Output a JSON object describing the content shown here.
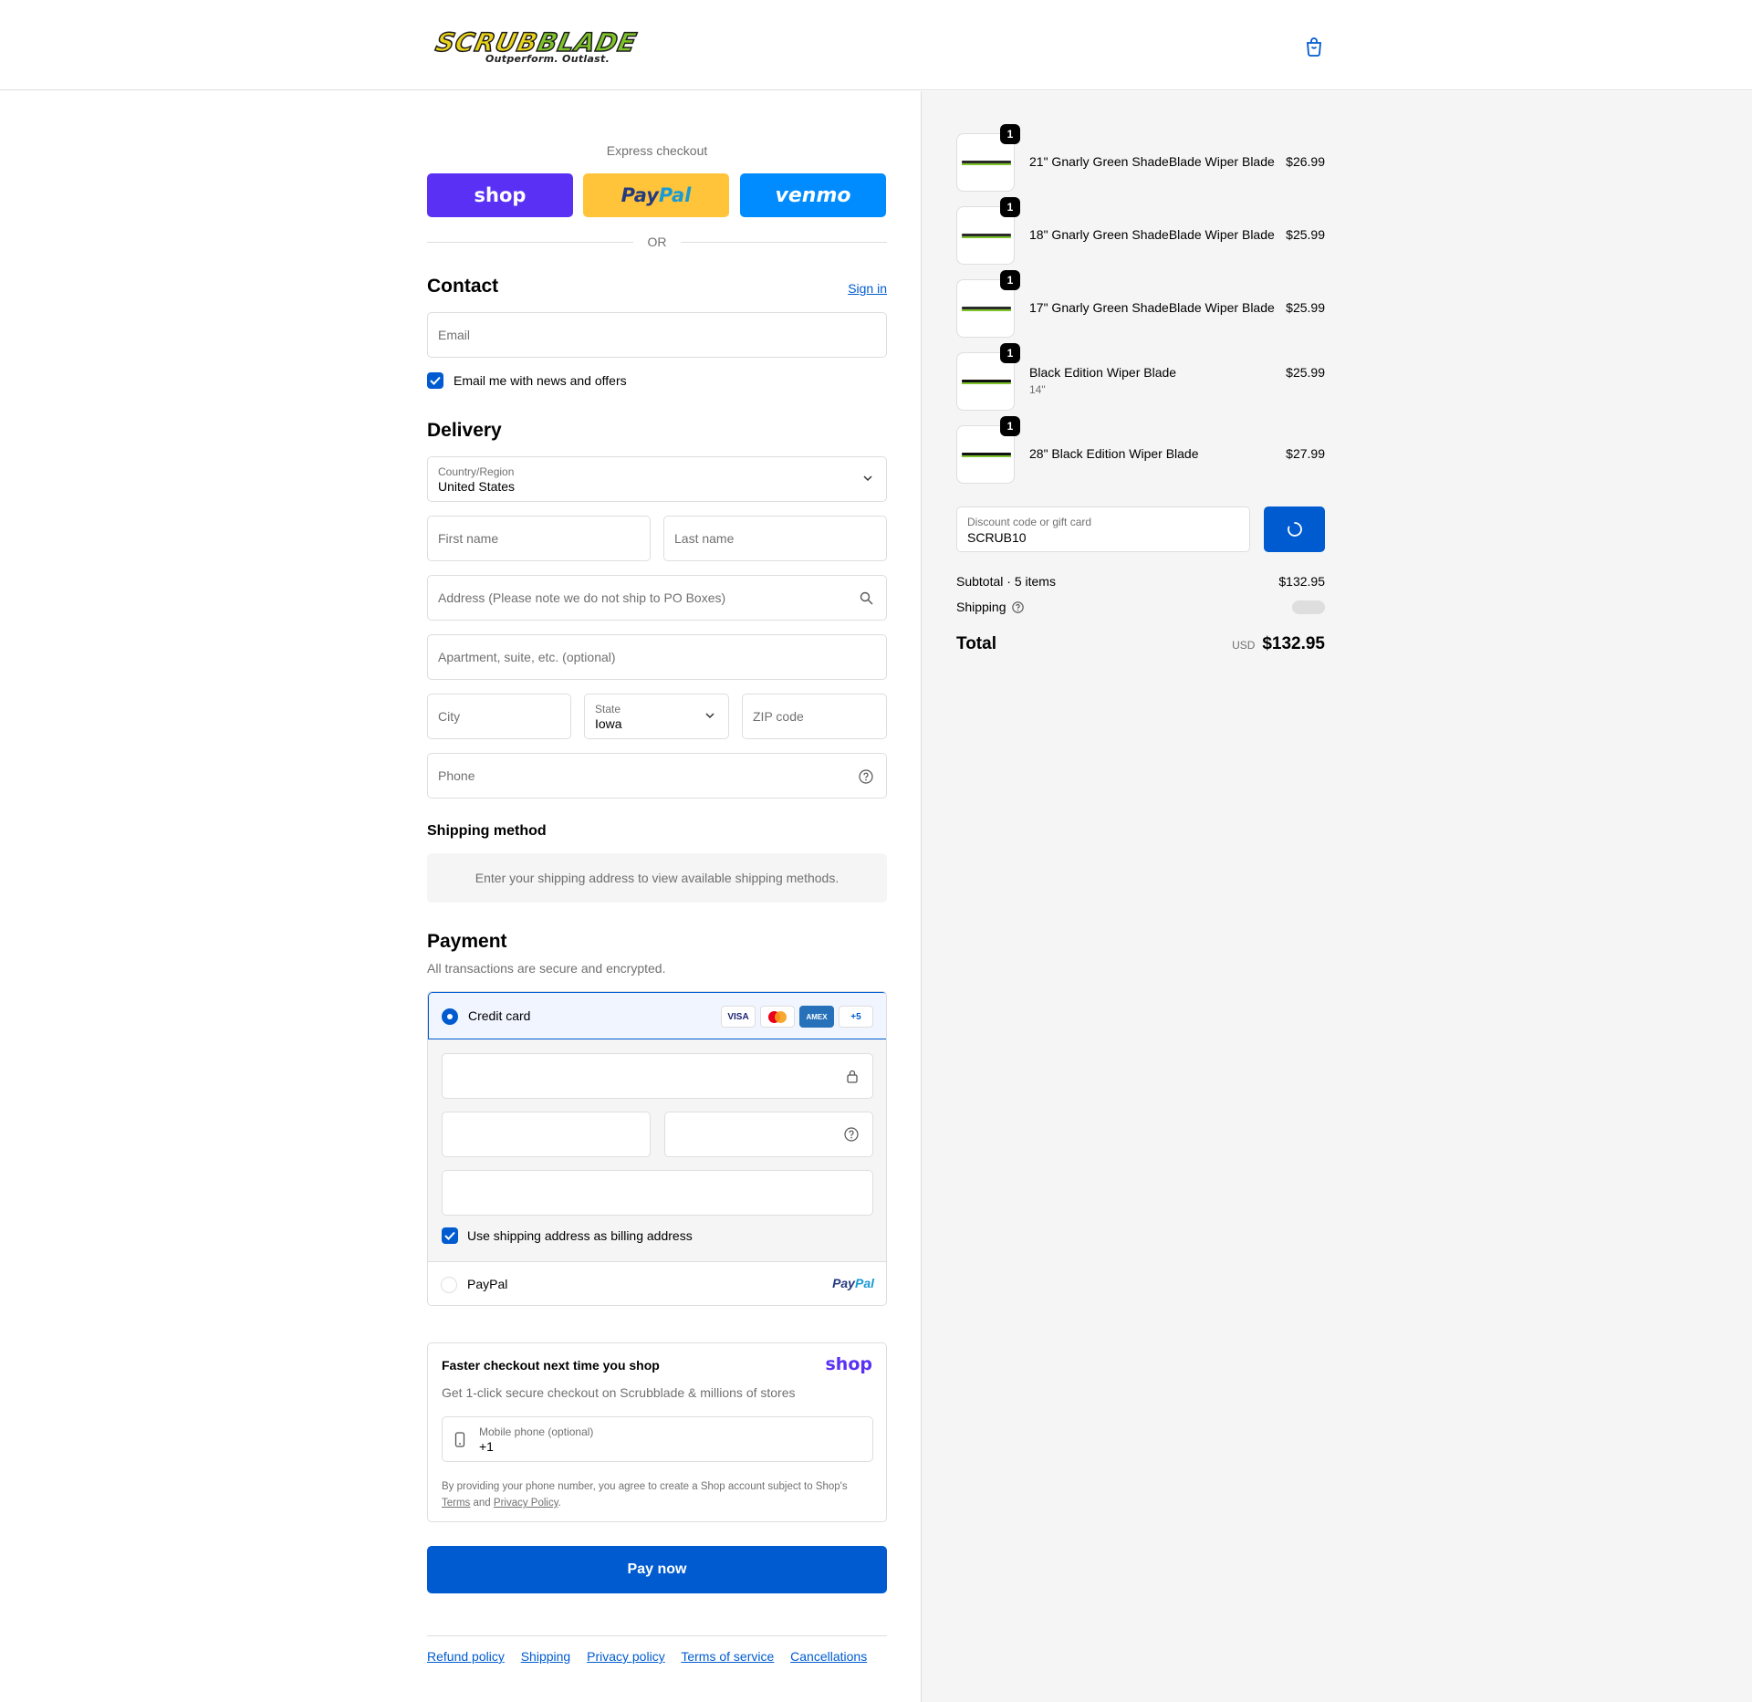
{
  "brand": {
    "logo_text_a": "SCRUB",
    "logo_text_b": "BLADE",
    "tagline": "Outperform. Outlast."
  },
  "express": {
    "title": "Express checkout",
    "shop_label": "shop",
    "paypal_label_a": "Pay",
    "paypal_label_b": "Pal",
    "venmo_label": "venmo",
    "or_label": "OR"
  },
  "contact": {
    "heading": "Contact",
    "sign_in": "Sign in",
    "email_placeholder": "Email",
    "newsletter_label": "Email me with news and offers",
    "newsletter_checked": true
  },
  "delivery": {
    "heading": "Delivery",
    "country_label": "Country/Region",
    "country_value": "United States",
    "first_name_placeholder": "First name",
    "last_name_placeholder": "Last name",
    "address_placeholder": "Address (Please note we do not ship to PO Boxes)",
    "apartment_placeholder": "Apartment, suite, etc. (optional)",
    "city_placeholder": "City",
    "state_label": "State",
    "state_value": "Iowa",
    "zip_placeholder": "ZIP code",
    "phone_placeholder": "Phone"
  },
  "shipping_method": {
    "heading": "Shipping method",
    "message": "Enter your shipping address to view available shipping methods."
  },
  "payment": {
    "heading": "Payment",
    "subtitle": "All transactions are secure and encrypted.",
    "credit_card_label": "Credit card",
    "card_brands": [
      "VISA",
      "MC",
      "AMEX",
      "+5"
    ],
    "billing_same_label": "Use shipping address as billing address",
    "billing_same_checked": true,
    "paypal_label": "PayPal",
    "paypal_logo_a": "Pay",
    "paypal_logo_b": "Pal"
  },
  "shop_pay": {
    "title": "Faster checkout next time you shop",
    "logo": "shop",
    "subtitle": "Get 1-click secure checkout on Scrubblade & millions of stores",
    "phone_label": "Mobile phone (optional)",
    "phone_value": "+1",
    "legal_prefix": "By providing your phone number, you agree to create a Shop account subject to Shop's",
    "terms_link": "Terms",
    "legal_and": "and",
    "privacy_link": "Privacy Policy",
    "legal_suffix": "."
  },
  "pay_now_label": "Pay now",
  "footer_links": [
    "Refund policy",
    "Shipping",
    "Privacy policy",
    "Terms of service",
    "Cancellations"
  ],
  "cart": {
    "items": [
      {
        "name": "21\" Gnarly Green ShadeBlade Wiper Blade",
        "variant": "",
        "price": "$26.99",
        "qty": "1"
      },
      {
        "name": "18\" Gnarly Green ShadeBlade Wiper Blade",
        "variant": "",
        "price": "$25.99",
        "qty": "1"
      },
      {
        "name": "17\" Gnarly Green ShadeBlade Wiper Blade",
        "variant": "",
        "price": "$25.99",
        "qty": "1"
      },
      {
        "name": "Black Edition Wiper Blade",
        "variant": "14\"",
        "price": "$25.99",
        "qty": "1"
      },
      {
        "name": "28\" Black Edition Wiper Blade",
        "variant": "",
        "price": "$27.99",
        "qty": "1"
      }
    ],
    "discount_label": "Discount code or gift card",
    "discount_value": "SCRUB10",
    "subtotal_label": "Subtotal · 5 items",
    "subtotal_value": "$132.95",
    "shipping_label": "Shipping",
    "total_label": "Total",
    "total_currency": "USD",
    "total_value": "$132.95"
  },
  "colors": {
    "primary": "#005bd1",
    "shop": "#5a31f4",
    "paypal": "#ffc439",
    "venmo": "#008cff",
    "sidebar_bg": "#f5f5f5"
  },
  "icons": [
    "cart-icon",
    "search-icon",
    "help-icon",
    "chevron-down-icon",
    "lock-icon",
    "mobile-icon",
    "spinner-icon",
    "check-icon"
  ]
}
